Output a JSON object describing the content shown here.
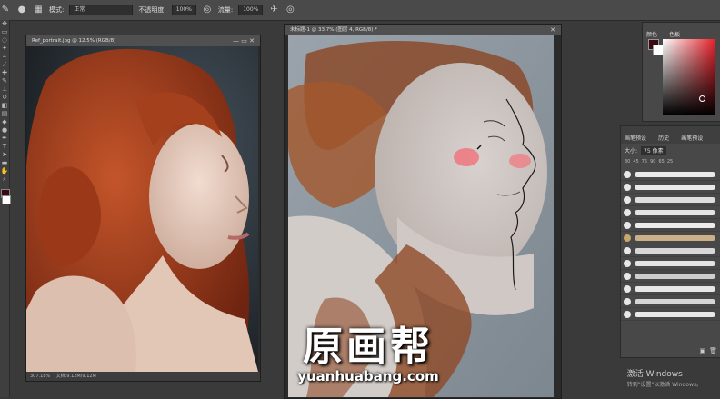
{
  "options_bar": {
    "mode_label": "模式:",
    "mode_value": "正常",
    "opacity_label": "不透明度:",
    "opacity_value": "100%",
    "flow_label": "流量:",
    "flow_value": "100%"
  },
  "doc_left": {
    "title": "Ref_portrait.jpg @ 12.5% (RGB/8)",
    "status_zoom": "307.18%",
    "status_doc": "文档:9.12M/9.12M"
  },
  "doc_right": {
    "title": "未标题-1 @ 33.7% (图层 4, RGB/8) *"
  },
  "color_panel": {
    "tab1": "颜色",
    "tab2": "色板"
  },
  "brush_panel": {
    "tab1": "画笔预设",
    "tab2": "历史",
    "tab3": "画笔预设",
    "size_label": "大小:",
    "size_value": "75 像素",
    "presets": [
      "30",
      "45",
      "75",
      "90",
      "65",
      "25"
    ]
  },
  "watermark": {
    "cn": "原画帮",
    "en": "yuanhuabang.com"
  },
  "windows_notice": {
    "line1": "激活 Windows",
    "line2": "转到\"设置\"以激活 Windows。"
  },
  "colors": {
    "ui_dark": "#3a3a3a",
    "panel": "#484848",
    "fg_color": "#3b0a10",
    "bg_color": "#ffffff",
    "hue_red": "#e8202a"
  }
}
